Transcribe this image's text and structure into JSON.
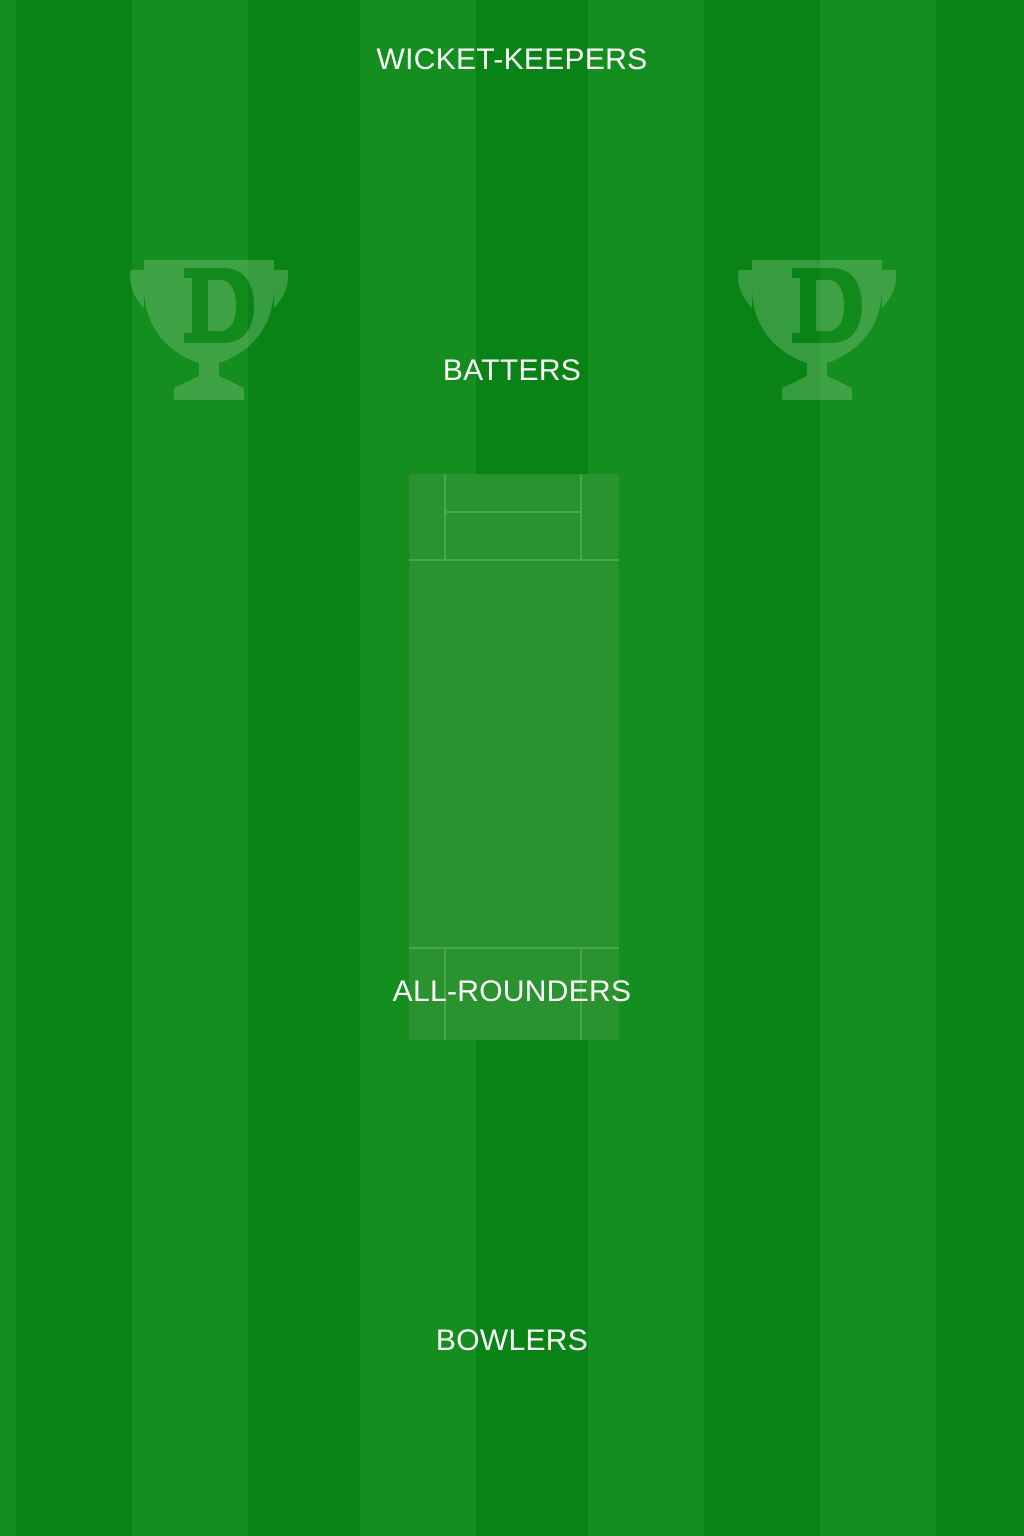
{
  "field": {
    "stripe_color_light": "#148e1e",
    "stripe_color_dark": "#0a8316",
    "pitch_color": "#2a922e",
    "logo_icon": "dream11-trophy-icon"
  },
  "sections": {
    "wicket_keepers": "WICKET-KEEPERS",
    "batters": "BATTERS",
    "all_rounders": "ALL-ROUNDERS",
    "bowlers": "BOWLERS"
  }
}
